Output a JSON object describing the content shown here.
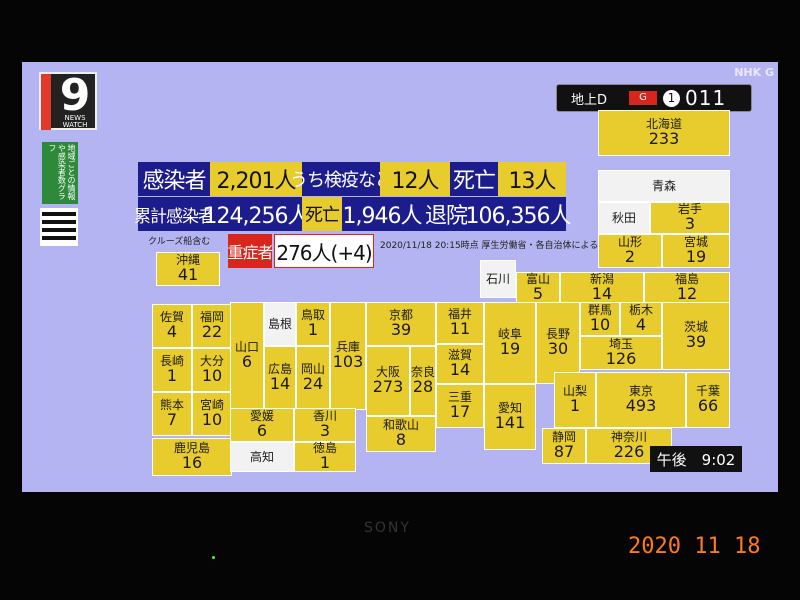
{
  "brand": {
    "logo_number": "9",
    "logo_text": "NEWS WATCH",
    "channel_corner": "NHK G"
  },
  "side_label": "地域ごとの情報や感染者数グラフ",
  "channel": {
    "label": "地上D",
    "badge": "G",
    "number": "011",
    "circle": "1"
  },
  "stats": {
    "infected_label": "感染者",
    "infected_value": "2,201人",
    "quarantine_label": "うち検疫など",
    "quarantine_value": "12人",
    "death_label": "死亡",
    "death_value": "13人",
    "cumulative_label": "累計感染者",
    "cumulative_value": "124,256人",
    "cum_death_label": "死亡",
    "cum_death_value": "1,946人",
    "discharged_label": "退院",
    "discharged_value": "106,356人",
    "severe_label": "重症者",
    "severe_value": "276人(+4)"
  },
  "notes": {
    "cruise": "クルーズ船含む",
    "timestamp": "2020/11/18 20:15時点 厚生労働省・各自治体による"
  },
  "prefectures": [
    {
      "name": "北海道",
      "count": "233"
    },
    {
      "name": "青森",
      "count": ""
    },
    {
      "name": "秋田",
      "count": ""
    },
    {
      "name": "岩手",
      "count": "3"
    },
    {
      "name": "山形",
      "count": "2"
    },
    {
      "name": "宮城",
      "count": "19"
    },
    {
      "name": "石川",
      "count": ""
    },
    {
      "name": "富山",
      "count": "5"
    },
    {
      "name": "新潟",
      "count": "14"
    },
    {
      "name": "福島",
      "count": "12"
    },
    {
      "name": "沖縄",
      "count": "41"
    },
    {
      "name": "佐賀",
      "count": "4"
    },
    {
      "name": "福岡",
      "count": "22"
    },
    {
      "name": "長崎",
      "count": "1"
    },
    {
      "name": "大分",
      "count": "10"
    },
    {
      "name": "熊本",
      "count": "7"
    },
    {
      "name": "宮崎",
      "count": "10"
    },
    {
      "name": "鹿児島",
      "count": "16"
    },
    {
      "name": "山口",
      "count": "6"
    },
    {
      "name": "島根",
      "count": ""
    },
    {
      "name": "鳥取",
      "count": "1"
    },
    {
      "name": "広島",
      "count": "14"
    },
    {
      "name": "岡山",
      "count": "24"
    },
    {
      "name": "兵庫",
      "count": "103"
    },
    {
      "name": "京都",
      "count": "39"
    },
    {
      "name": "大阪",
      "count": "273"
    },
    {
      "name": "奈良",
      "count": "28"
    },
    {
      "name": "和歌山",
      "count": "8"
    },
    {
      "name": "福井",
      "count": "11"
    },
    {
      "name": "滋賀",
      "count": "14"
    },
    {
      "name": "三重",
      "count": "17"
    },
    {
      "name": "岐阜",
      "count": "19"
    },
    {
      "name": "愛知",
      "count": "141"
    },
    {
      "name": "長野",
      "count": "30"
    },
    {
      "name": "群馬",
      "count": "10"
    },
    {
      "name": "栃木",
      "count": "4"
    },
    {
      "name": "茨城",
      "count": "39"
    },
    {
      "name": "埼玉",
      "count": "126"
    },
    {
      "name": "山梨",
      "count": "1"
    },
    {
      "name": "東京",
      "count": "493"
    },
    {
      "name": "千葉",
      "count": "66"
    },
    {
      "name": "静岡",
      "count": "87"
    },
    {
      "name": "神奈川",
      "count": "226"
    },
    {
      "name": "愛媛",
      "count": "6"
    },
    {
      "name": "香川",
      "count": "3"
    },
    {
      "name": "高知",
      "count": ""
    },
    {
      "name": "徳島",
      "count": "1"
    }
  ],
  "clock": "午後　9:02",
  "tv_brand": "SONY",
  "photo_date": "2020  11  18"
}
